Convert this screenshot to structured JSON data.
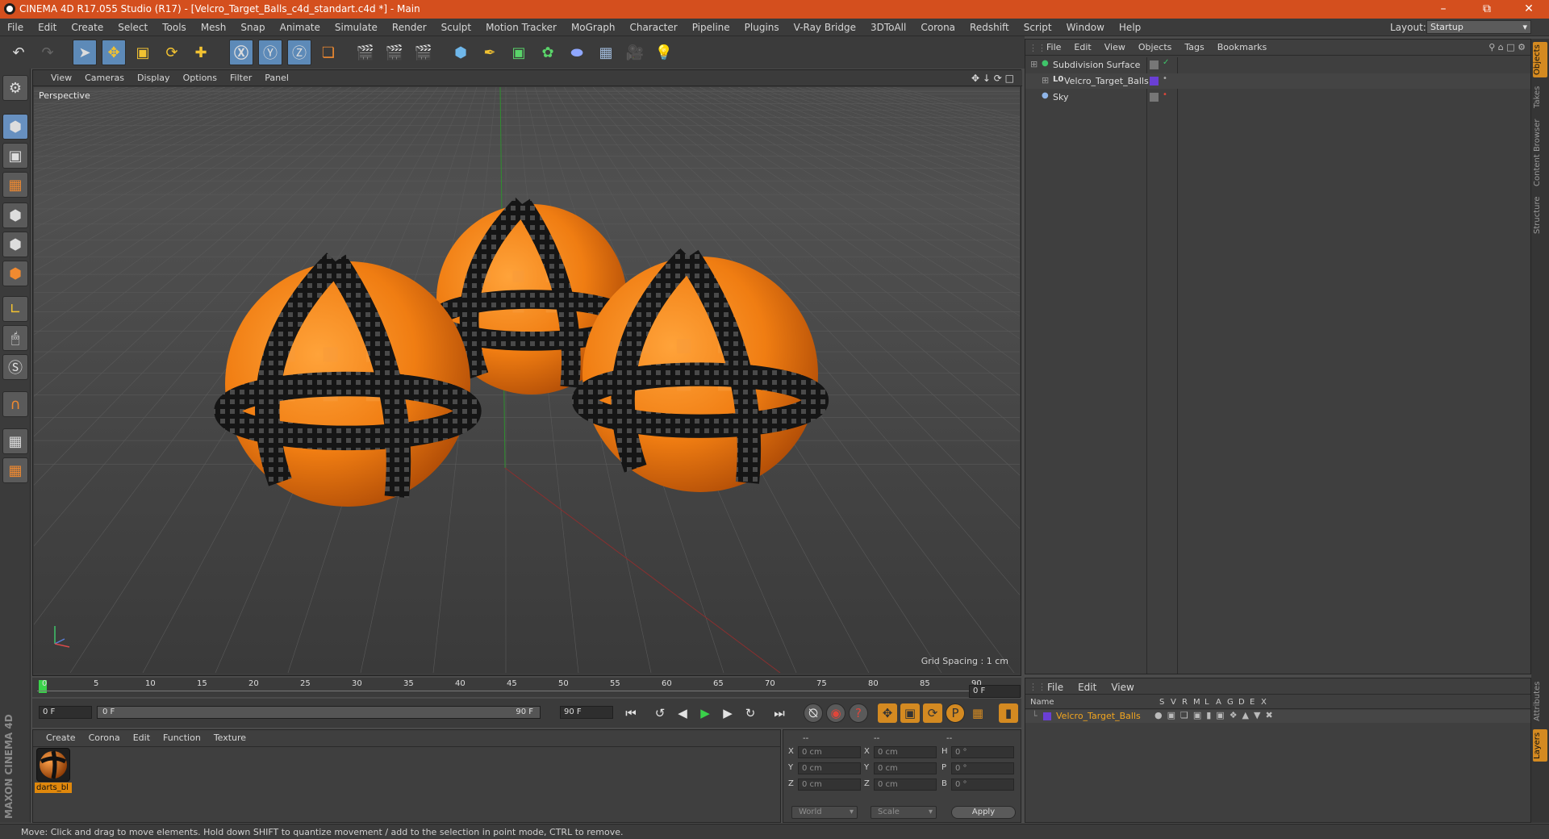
{
  "window": {
    "title": "CINEMA 4D R17.055 Studio (R17) - [Velcro_Target_Balls_c4d_standart.c4d *] - Main"
  },
  "menubar": {
    "items": [
      "File",
      "Edit",
      "Create",
      "Select",
      "Tools",
      "Mesh",
      "Snap",
      "Animate",
      "Simulate",
      "Render",
      "Sculpt",
      "Motion Tracker",
      "MoGraph",
      "Character",
      "Pipeline",
      "Plugins",
      "V-Ray Bridge",
      "3DToAll",
      "Corona",
      "Redshift",
      "Script",
      "Window",
      "Help"
    ]
  },
  "layout": {
    "label": "Layout:",
    "value": "Startup"
  },
  "viewport": {
    "menu": [
      "View",
      "Cameras",
      "Display",
      "Options",
      "Filter",
      "Panel"
    ],
    "name": "Perspective",
    "grid_spacing": "Grid Spacing : 1 cm"
  },
  "timeline": {
    "ticks": [
      "0",
      "5",
      "10",
      "15",
      "20",
      "25",
      "30",
      "35",
      "40",
      "45",
      "50",
      "55",
      "60",
      "65",
      "70",
      "75",
      "80",
      "85",
      "90"
    ],
    "current_frame": "0 F",
    "start_field": "0 F",
    "range_start": "0 F",
    "range_end": "90 F",
    "end_field": "90 F"
  },
  "material_manager": {
    "menu": [
      "Create",
      "Corona",
      "Edit",
      "Function",
      "Texture"
    ],
    "materials": [
      {
        "name": "darts_bl"
      }
    ]
  },
  "coordinates": {
    "headers": [
      "--",
      "--",
      "--"
    ],
    "rows": [
      {
        "l1": "X",
        "v1": "0 cm",
        "l2": "X",
        "v2": "0 cm",
        "l3": "H",
        "v3": "0 °"
      },
      {
        "l1": "Y",
        "v1": "0 cm",
        "l2": "Y",
        "v2": "0 cm",
        "l3": "P",
        "v3": "0 °"
      },
      {
        "l1": "Z",
        "v1": "0 cm",
        "l2": "Z",
        "v2": "0 cm",
        "l3": "B",
        "v3": "0 °"
      }
    ],
    "mode": "World",
    "transform": "Scale",
    "apply": "Apply"
  },
  "object_manager": {
    "menu": [
      "File",
      "Edit",
      "View",
      "Objects",
      "Tags",
      "Bookmarks"
    ],
    "objects": [
      {
        "name": "Subdivision Surface"
      },
      {
        "name": "Velcro_Target_Balls"
      },
      {
        "name": "Sky"
      }
    ]
  },
  "layer_manager": {
    "menu": [
      "File",
      "Edit",
      "View"
    ],
    "columns": [
      "Name",
      "S",
      "V",
      "R",
      "M",
      "L",
      "A",
      "G",
      "D",
      "E",
      "X"
    ],
    "layers": [
      {
        "name": "Velcro_Target_Balls",
        "color": "#6a3fd4"
      }
    ]
  },
  "side_tabs": [
    "Objects",
    "Takes",
    "Content Browser",
    "Structure",
    "Attributes",
    "Layers"
  ],
  "status": "Move: Click and drag to move elements. Hold down SHIFT to quantize movement / add to the selection in point mode, CTRL to remove.",
  "brand": "MAXON CINEMA 4D",
  "colors": {
    "accent": "#d44f1e",
    "ball": "#f07d12",
    "selection": "#5d8ab8",
    "material_label": "#e0880c"
  }
}
